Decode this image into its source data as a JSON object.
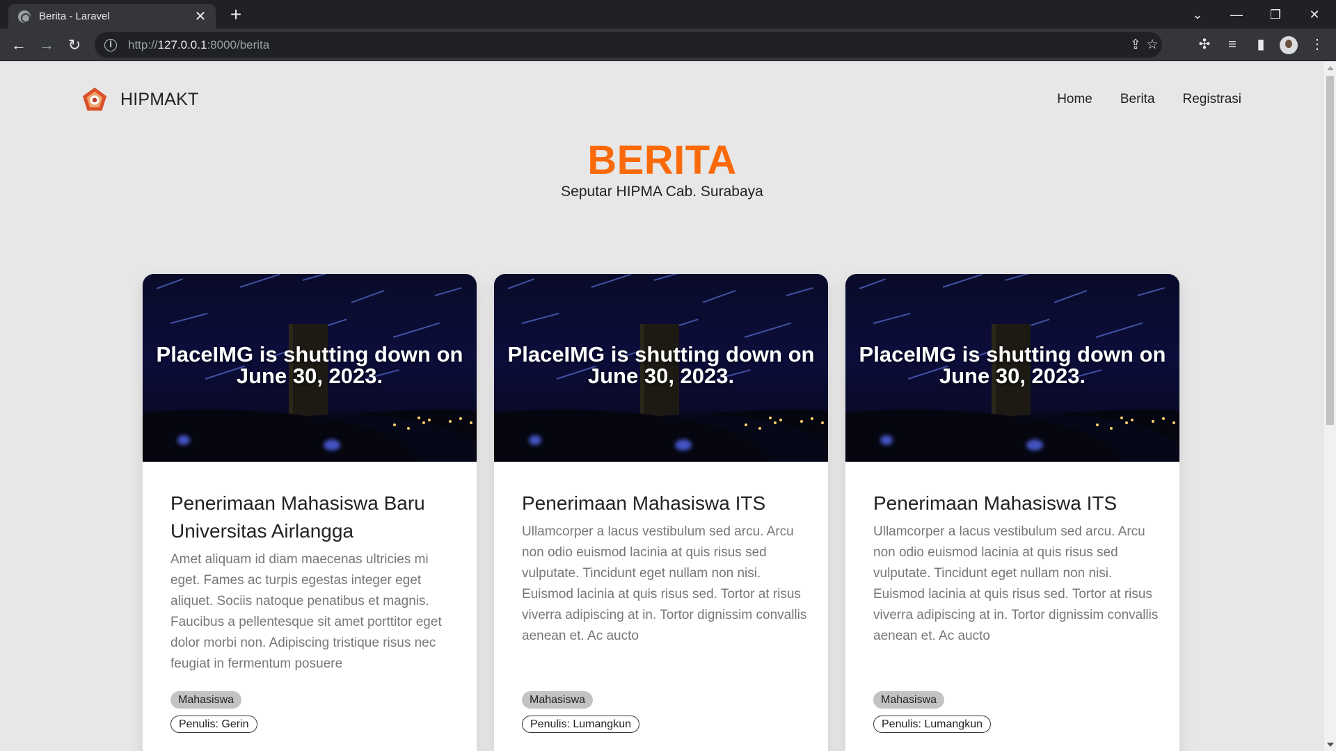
{
  "browser": {
    "tab_title": "Berita - Laravel",
    "tab_close": "✕",
    "new_tab": "+",
    "url_scheme": "http://",
    "url_host": "127.0.0.1",
    "url_path": ":8000/berita",
    "window_controls": {
      "dropdown": "⌄",
      "minimize": "—",
      "restore": "❐",
      "close": "✕"
    }
  },
  "nav": {
    "brand": "HIPMAKT",
    "links": [
      "Home",
      "Berita",
      "Registrasi"
    ]
  },
  "header": {
    "title": "BERITA",
    "subtitle": "Seputar HIPMA Cab. Surabaya"
  },
  "cards": [
    {
      "image_text": "PlaceIMG is shutting down on June 30, 2023.",
      "title": "Penerimaan Mahasiswa Baru Universitas Airlangga",
      "excerpt": "Amet aliquam id diam maecenas ultricies mi eget. Fames ac turpis egestas integer eget aliquet. Sociis natoque penatibus et magnis. Faucibus a pellentesque sit amet porttitor eget dolor morbi non. Adipiscing tristique risus nec feugiat in fermentum posuere",
      "category": "Mahasiswa",
      "author": "Penulis: Gerin"
    },
    {
      "image_text": "PlaceIMG is shutting down on June 30, 2023.",
      "title": "Penerimaan Mahasiswa ITS",
      "excerpt": "Ullamcorper a lacus vestibulum sed arcu. Arcu non odio euismod lacinia at quis risus sed vulputate. Tincidunt eget nullam non nisi. Euismod lacinia at quis risus sed. Tortor at risus viverra adipiscing at in. Tortor dignissim convallis aenean et. Ac aucto",
      "category": "Mahasiswa",
      "author": "Penulis: Lumangkun"
    },
    {
      "image_text": "PlaceIMG is shutting down on June 30, 2023.",
      "title": "Penerimaan Mahasiswa ITS",
      "excerpt": "Ullamcorper a lacus vestibulum sed arcu. Arcu non odio euismod lacinia at quis risus sed vulputate. Tincidunt eget nullam non nisi. Euismod lacinia at quis risus sed. Tortor at risus viverra adipiscing at in. Tortor dignissim convallis aenean et. Ac aucto",
      "category": "Mahasiswa",
      "author": "Penulis: Lumangkun"
    }
  ],
  "colors": {
    "accent": "#fb6a09",
    "page_bg": "#e7e7e7",
    "chrome_dark": "#202124",
    "chrome_toolbar": "#35363a"
  },
  "icons": [
    "globe-icon",
    "back-arrow-icon",
    "forward-arrow-icon",
    "reload-icon",
    "info-icon",
    "share-icon",
    "star-icon",
    "extensions-icon",
    "media-icon",
    "side-panel-icon",
    "profile-avatar",
    "kebab-menu-icon"
  ]
}
